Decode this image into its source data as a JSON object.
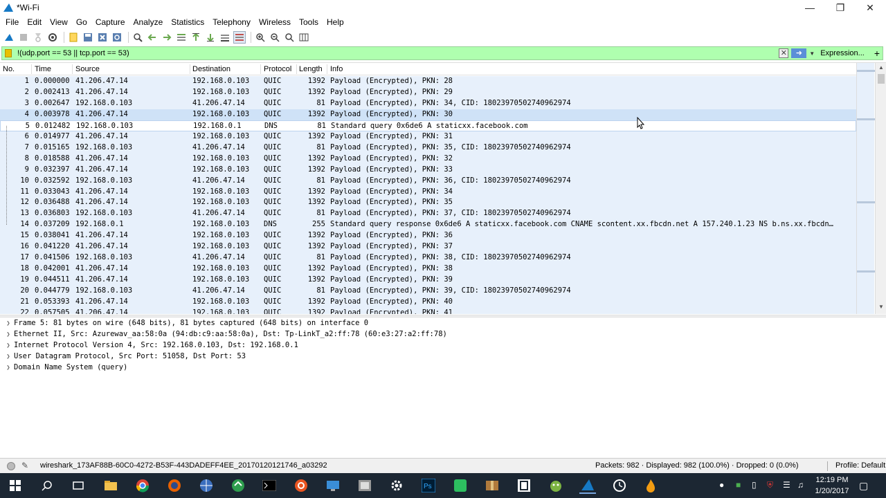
{
  "window": {
    "title": "*Wi-Fi"
  },
  "menu": [
    "File",
    "Edit",
    "View",
    "Go",
    "Capture",
    "Analyze",
    "Statistics",
    "Telephony",
    "Wireless",
    "Tools",
    "Help"
  ],
  "filter": {
    "text": "!(udp.port == 53 || tcp.port == 53)",
    "expression_label": "Expression...",
    "plus": "+"
  },
  "columns": {
    "no": "No.",
    "time": "Time",
    "source": "Source",
    "destination": "Destination",
    "protocol": "Protocol",
    "length": "Length",
    "info": "Info"
  },
  "packets": [
    {
      "no": "1",
      "time": "0.000000",
      "src": "41.206.47.14",
      "dst": "192.168.0.103",
      "proto": "QUIC",
      "len": "1392",
      "info": "Payload (Encrypted), PKN: 28"
    },
    {
      "no": "2",
      "time": "0.002413",
      "src": "41.206.47.14",
      "dst": "192.168.0.103",
      "proto": "QUIC",
      "len": "1392",
      "info": "Payload (Encrypted), PKN: 29"
    },
    {
      "no": "3",
      "time": "0.002647",
      "src": "192.168.0.103",
      "dst": "41.206.47.14",
      "proto": "QUIC",
      "len": "81",
      "info": "Payload (Encrypted), PKN: 34, CID: 18023970502740962974"
    },
    {
      "no": "4",
      "time": "0.003978",
      "src": "41.206.47.14",
      "dst": "192.168.0.103",
      "proto": "QUIC",
      "len": "1392",
      "info": "Payload (Encrypted), PKN: 30"
    },
    {
      "no": "5",
      "time": "0.012482",
      "src": "192.168.0.103",
      "dst": "192.168.0.1",
      "proto": "DNS",
      "len": "81",
      "info": "Standard query 0x6de6 A staticxx.facebook.com"
    },
    {
      "no": "6",
      "time": "0.014977",
      "src": "41.206.47.14",
      "dst": "192.168.0.103",
      "proto": "QUIC",
      "len": "1392",
      "info": "Payload (Encrypted), PKN: 31"
    },
    {
      "no": "7",
      "time": "0.015165",
      "src": "192.168.0.103",
      "dst": "41.206.47.14",
      "proto": "QUIC",
      "len": "81",
      "info": "Payload (Encrypted), PKN: 35, CID: 18023970502740962974"
    },
    {
      "no": "8",
      "time": "0.018588",
      "src": "41.206.47.14",
      "dst": "192.168.0.103",
      "proto": "QUIC",
      "len": "1392",
      "info": "Payload (Encrypted), PKN: 32"
    },
    {
      "no": "9",
      "time": "0.032397",
      "src": "41.206.47.14",
      "dst": "192.168.0.103",
      "proto": "QUIC",
      "len": "1392",
      "info": "Payload (Encrypted), PKN: 33"
    },
    {
      "no": "10",
      "time": "0.032592",
      "src": "192.168.0.103",
      "dst": "41.206.47.14",
      "proto": "QUIC",
      "len": "81",
      "info": "Payload (Encrypted), PKN: 36, CID: 18023970502740962974"
    },
    {
      "no": "11",
      "time": "0.033043",
      "src": "41.206.47.14",
      "dst": "192.168.0.103",
      "proto": "QUIC",
      "len": "1392",
      "info": "Payload (Encrypted), PKN: 34"
    },
    {
      "no": "12",
      "time": "0.036488",
      "src": "41.206.47.14",
      "dst": "192.168.0.103",
      "proto": "QUIC",
      "len": "1392",
      "info": "Payload (Encrypted), PKN: 35"
    },
    {
      "no": "13",
      "time": "0.036803",
      "src": "192.168.0.103",
      "dst": "41.206.47.14",
      "proto": "QUIC",
      "len": "81",
      "info": "Payload (Encrypted), PKN: 37, CID: 18023970502740962974"
    },
    {
      "no": "14",
      "time": "0.037209",
      "src": "192.168.0.1",
      "dst": "192.168.0.103",
      "proto": "DNS",
      "len": "255",
      "info": "Standard query response 0x6de6 A staticxx.facebook.com CNAME scontent.xx.fbcdn.net A 157.240.1.23 NS b.ns.xx.fbcdn…"
    },
    {
      "no": "15",
      "time": "0.038041",
      "src": "41.206.47.14",
      "dst": "192.168.0.103",
      "proto": "QUIC",
      "len": "1392",
      "info": "Payload (Encrypted), PKN: 36"
    },
    {
      "no": "16",
      "time": "0.041220",
      "src": "41.206.47.14",
      "dst": "192.168.0.103",
      "proto": "QUIC",
      "len": "1392",
      "info": "Payload (Encrypted), PKN: 37"
    },
    {
      "no": "17",
      "time": "0.041506",
      "src": "192.168.0.103",
      "dst": "41.206.47.14",
      "proto": "QUIC",
      "len": "81",
      "info": "Payload (Encrypted), PKN: 38, CID: 18023970502740962974"
    },
    {
      "no": "18",
      "time": "0.042001",
      "src": "41.206.47.14",
      "dst": "192.168.0.103",
      "proto": "QUIC",
      "len": "1392",
      "info": "Payload (Encrypted), PKN: 38"
    },
    {
      "no": "19",
      "time": "0.044511",
      "src": "41.206.47.14",
      "dst": "192.168.0.103",
      "proto": "QUIC",
      "len": "1392",
      "info": "Payload (Encrypted), PKN: 39"
    },
    {
      "no": "20",
      "time": "0.044779",
      "src": "192.168.0.103",
      "dst": "41.206.47.14",
      "proto": "QUIC",
      "len": "81",
      "info": "Payload (Encrypted), PKN: 39, CID: 18023970502740962974"
    },
    {
      "no": "21",
      "time": "0.053393",
      "src": "41.206.47.14",
      "dst": "192.168.0.103",
      "proto": "QUIC",
      "len": "1392",
      "info": "Payload (Encrypted), PKN: 40"
    },
    {
      "no": "22",
      "time": "0.057505",
      "src": "41.206.47.14",
      "dst": "192.168.0.103",
      "proto": "QUIC",
      "len": "1392",
      "info": "Payload (Encrypted), PKN: 41"
    }
  ],
  "selected_packet": "5",
  "details": [
    "Frame 5: 81 bytes on wire (648 bits), 81 bytes captured (648 bits) on interface 0",
    "Ethernet II, Src: Azurewav_aa:58:0a (94:db:c9:aa:58:0a), Dst: Tp-LinkT_a2:ff:78 (60:e3:27:a2:ff:78)",
    "Internet Protocol Version 4, Src: 192.168.0.103, Dst: 192.168.0.1",
    "User Datagram Protocol, Src Port: 51058, Dst Port: 53",
    "Domain Name System (query)"
  ],
  "status": {
    "file": "wireshark_173AF88B-60C0-4272-B53F-443DADEFF4EE_20170120121746_a03292",
    "stats": "Packets: 982 · Displayed: 982 (100.0%) · Dropped: 0 (0.0%)",
    "profile": "Profile: Default"
  },
  "clock": {
    "time": "12:19 PM",
    "date": "1/20/2017"
  },
  "colors": {
    "row_bg": "#e7f0fb",
    "filter_ok": "#afffaf",
    "taskbar": "#1c2733"
  }
}
